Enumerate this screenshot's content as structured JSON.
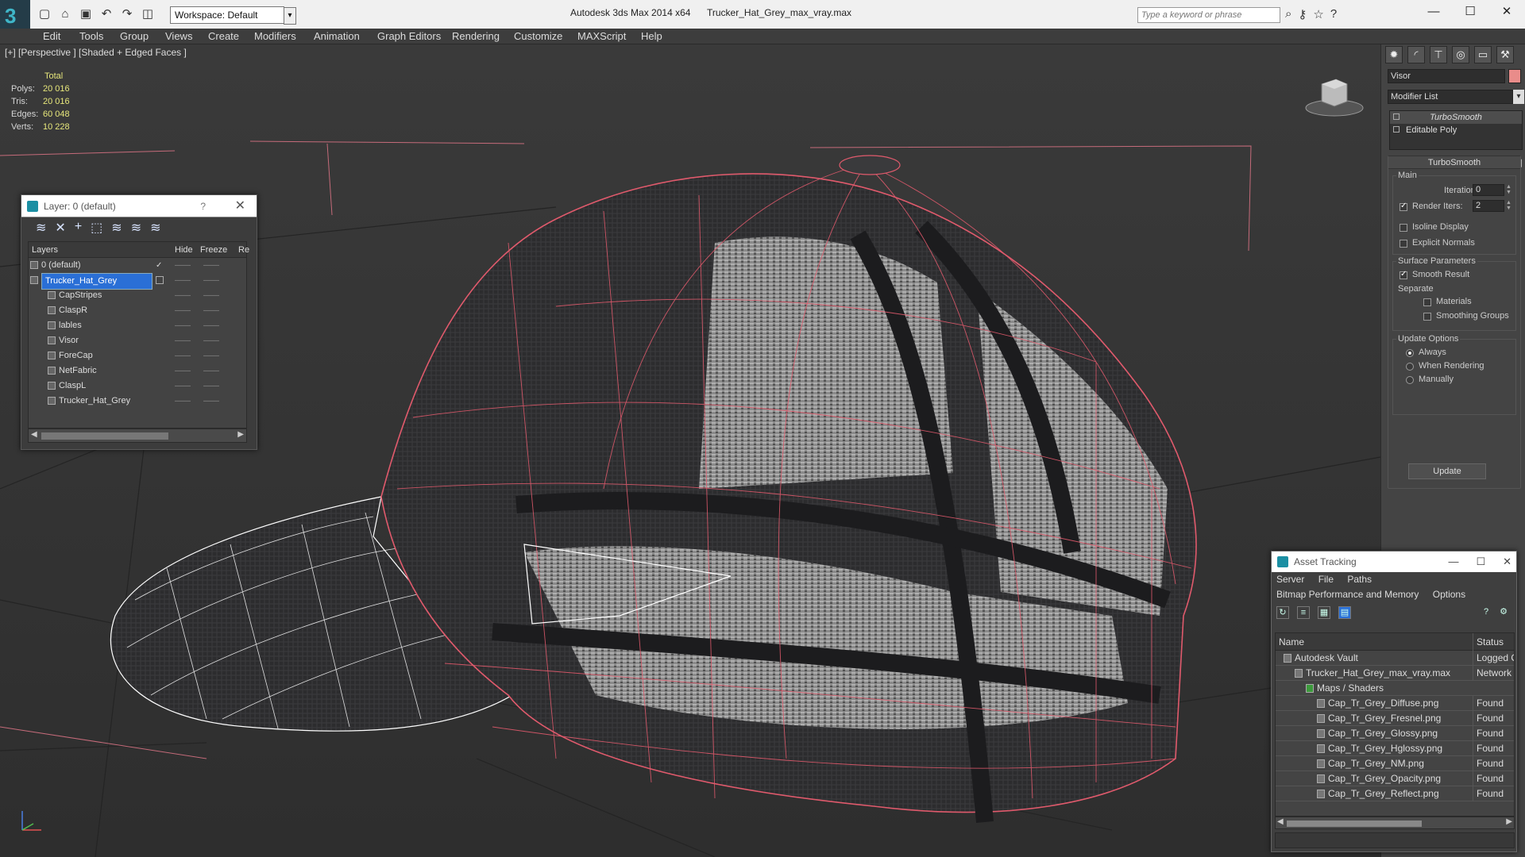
{
  "titlebar": {
    "workspace_label": "Workspace: Default",
    "app_name": "Autodesk 3ds Max  2014 x64",
    "file_name": "Trucker_Hat_Grey_max_vray.max",
    "search_placeholder": "Type a keyword or phrase"
  },
  "menu": [
    "Edit",
    "Tools",
    "Group",
    "Views",
    "Create",
    "Modifiers",
    "Animation",
    "Graph Editors",
    "Rendering",
    "Customize",
    "MAXScript",
    "Help"
  ],
  "viewport": {
    "label": "[+] [Perspective ] [Shaded + Edged Faces ]",
    "stats": {
      "header": "Total",
      "rows": [
        {
          "k": "Polys:",
          "v": "20 016"
        },
        {
          "k": "Tris:",
          "v": "20 016"
        },
        {
          "k": "Edges:",
          "v": "60 048"
        },
        {
          "k": "Verts:",
          "v": "10 228"
        }
      ]
    }
  },
  "layer_dialog": {
    "title": "Layer: 0 (default)",
    "help": "?",
    "columns": [
      "Layers",
      "Hide",
      "Freeze",
      "Re"
    ],
    "rows": [
      {
        "name": "0 (default)",
        "level": 0
      },
      {
        "name": "Trucker_Hat_Grey",
        "level": 0,
        "selected": true
      },
      {
        "name": "CapStripes",
        "level": 1
      },
      {
        "name": "ClaspR",
        "level": 1
      },
      {
        "name": "lables",
        "level": 1
      },
      {
        "name": "Visor",
        "level": 1
      },
      {
        "name": "ForeCap",
        "level": 1
      },
      {
        "name": "NetFabric",
        "level": 1
      },
      {
        "name": "ClaspL",
        "level": 1
      },
      {
        "name": "Trucker_Hat_Grey",
        "level": 1
      }
    ]
  },
  "command_panel": {
    "object_name": "Visor",
    "object_color": "#e98c8a",
    "modifier_list": "Modifier List",
    "stack": [
      "TurboSmooth",
      "Editable Poly"
    ],
    "rollout_title": "TurboSmooth",
    "main_group": "Main",
    "iterations_label": "Iterations:",
    "iterations_value": "0",
    "render_iters_label": "Render Iters:",
    "render_iters_value": "2",
    "isoline_label": "Isoline Display",
    "explicit_label": "Explicit Normals",
    "surface_group": "Surface Parameters",
    "smooth_result_label": "Smooth Result",
    "separate_label": "Separate",
    "materials_label": "Materials",
    "smoothing_groups_label": "Smoothing Groups",
    "update_group": "Update Options",
    "always_label": "Always",
    "when_rendering_label": "When Rendering",
    "manually_label": "Manually",
    "update_button": "Update"
  },
  "asset_dialog": {
    "title": "Asset Tracking",
    "menu1": [
      "Server",
      "File",
      "Paths"
    ],
    "menu2": [
      "Bitmap Performance and Memory",
      "Options"
    ],
    "columns": [
      "Name",
      "Status"
    ],
    "rows": [
      {
        "name": "Autodesk Vault",
        "status": "Logged Ou",
        "level": 1
      },
      {
        "name": "Trucker_Hat_Grey_max_vray.max",
        "status": "Network P",
        "level": 2
      },
      {
        "name": "Maps / Shaders",
        "status": "",
        "level": 3
      },
      {
        "name": "Cap_Tr_Grey_Diffuse.png",
        "status": "Found",
        "level": 4
      },
      {
        "name": "Cap_Tr_Grey_Fresnel.png",
        "status": "Found",
        "level": 4
      },
      {
        "name": "Cap_Tr_Grey_Glossy.png",
        "status": "Found",
        "level": 4
      },
      {
        "name": "Cap_Tr_Grey_Hglossy.png",
        "status": "Found",
        "level": 4
      },
      {
        "name": "Cap_Tr_Grey_NM.png",
        "status": "Found",
        "level": 4
      },
      {
        "name": "Cap_Tr_Grey_Opacity.png",
        "status": "Found",
        "level": 4
      },
      {
        "name": "Cap_Tr_Grey_Reflect.png",
        "status": "Found",
        "level": 4
      }
    ]
  }
}
